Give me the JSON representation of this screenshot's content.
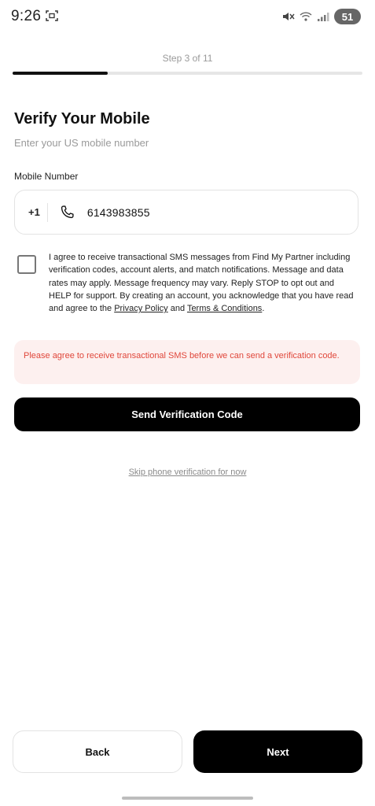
{
  "status_bar": {
    "time": "9:26",
    "battery": "51",
    "icons": [
      "screenshot-icon",
      "mute-icon",
      "wifi-icon",
      "signal-icon"
    ]
  },
  "stepper": {
    "label": "Step 3 of 11",
    "progress": 0.273
  },
  "page": {
    "title": "Verify Your Mobile",
    "subtitle": "Enter your US mobile number"
  },
  "phone_field": {
    "label": "Mobile Number",
    "country_code": "+1",
    "value": "6143983855",
    "icon": "phone-icon"
  },
  "consent": {
    "checked": false,
    "text_start": "I agree to receive transactional SMS messages from Find My Partner including verification codes, account alerts, and match notifications. Message and data rates may apply. Message frequency may vary. Reply STOP to opt out and HELP for support. By creating an account, you acknowledge that you have read and agree to the ",
    "privacy_link": "Privacy Policy",
    "text_middle": " and ",
    "terms_link": "Terms & Conditions",
    "text_end": "."
  },
  "error": {
    "message": "Please agree to receive transactional SMS before we can send a verification code."
  },
  "buttons": {
    "send_label": "Send Verification Code",
    "skip_label": "Skip phone verification for now",
    "back_label": "Back",
    "next_label": "Next"
  },
  "colors": {
    "accent": "#000000",
    "error_text": "#e0473b",
    "error_bg": "#fdf0ef",
    "muted_text": "#9a9a9a"
  }
}
